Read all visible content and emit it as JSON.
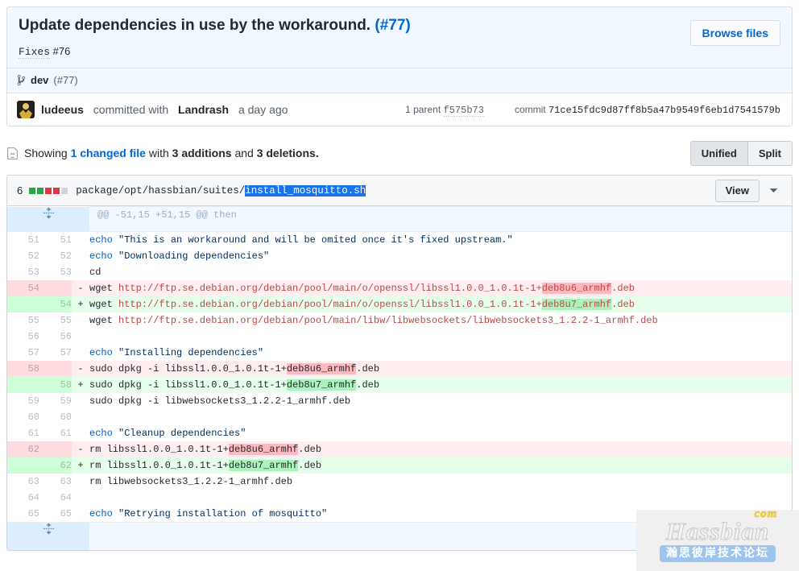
{
  "commit": {
    "title": "Update dependencies in use by the workaround.",
    "title_issue": "(#77)",
    "description_keyword": "Fixes",
    "description_issue": "#76",
    "browse_files_label": "Browse files",
    "branch_icon": "branch-icon",
    "branch_name": "dev",
    "branch_pr": "(#77)",
    "author": "ludeeus",
    "committed_with_text": "committed with",
    "coauthor": "Landrash",
    "time": "a day ago",
    "parent_label": "1 parent",
    "parent_sha": "f575b73",
    "commit_label": "commit",
    "commit_sha": "71ce15fdc9d87ff8b5a47b9549f6eb1d7541579b"
  },
  "toolbar": {
    "file_icon": "file-diff-icon",
    "showing": "Showing",
    "changed_files": "1 changed file",
    "with": "with",
    "additions": "3 additions",
    "and": "and",
    "deletions": "3 deletions.",
    "unified_label": "Unified",
    "split_label": "Split",
    "active_view": "Unified"
  },
  "file": {
    "change_count": "6",
    "diffstat": [
      "add",
      "add",
      "del",
      "del",
      "neu"
    ],
    "path_prefix": "package/opt/hassbian/suites/",
    "path_selected": "install_mosquitto.sh",
    "view_label": "View",
    "chevron_icon": "chevron-down-icon",
    "hunk_header": "@@ -51,15 +51,15 @@ then",
    "expand_icon": "unfold-icon"
  },
  "colors": {
    "accent": "#0366d6",
    "addition": "#28a745",
    "deletion": "#d73a49",
    "header_bg": "#f1f8ff",
    "selection": "#1a73e8"
  },
  "watermark": {
    "brand": "Hassbian",
    "tld": "com",
    "cn": "瀚思彼岸技术论坛"
  },
  "diff": {
    "rows": [
      {
        "type": "ctx",
        "old": "51",
        "new": "51",
        "marker": "",
        "parts": [
          {
            "t": "kw",
            "s": "echo"
          },
          {
            "t": "plain",
            "s": " "
          },
          {
            "t": "str",
            "s": "\"This is an workaround and will be omited once it's fixed upstream.\""
          }
        ]
      },
      {
        "type": "ctx",
        "old": "52",
        "new": "52",
        "marker": "",
        "parts": [
          {
            "t": "kw",
            "s": "echo"
          },
          {
            "t": "plain",
            "s": " "
          },
          {
            "t": "str",
            "s": "\"Downloading dependencies\""
          }
        ]
      },
      {
        "type": "ctx",
        "old": "53",
        "new": "53",
        "marker": "",
        "parts": [
          {
            "t": "plain",
            "s": "cd"
          }
        ]
      },
      {
        "type": "del",
        "old": "54",
        "new": "",
        "marker": "-",
        "parts": [
          {
            "t": "plain",
            "s": "wget "
          },
          {
            "t": "url",
            "s": "http://ftp.se.debian.org/debian/pool/main/o/openssl/libssl1.0.0_1.0.1t-1+"
          },
          {
            "t": "url",
            "s": "deb8u6_armhf",
            "hl": "del"
          },
          {
            "t": "url",
            "s": ".deb"
          }
        ]
      },
      {
        "type": "add",
        "old": "",
        "new": "54",
        "marker": "+",
        "parts": [
          {
            "t": "plain",
            "s": "wget "
          },
          {
            "t": "url",
            "s": "http://ftp.se.debian.org/debian/pool/main/o/openssl/libssl1.0.0_1.0.1t-1+"
          },
          {
            "t": "url",
            "s": "deb8u7_armhf",
            "hl": "add"
          },
          {
            "t": "url",
            "s": ".deb"
          }
        ]
      },
      {
        "type": "ctx",
        "old": "55",
        "new": "55",
        "marker": "",
        "parts": [
          {
            "t": "plain",
            "s": "wget "
          },
          {
            "t": "url",
            "s": "http://ftp.se.debian.org/debian/pool/main/libw/libwebsockets/libwebsockets3_1.2.2-1_armhf.deb"
          }
        ]
      },
      {
        "type": "ctx",
        "old": "56",
        "new": "56",
        "marker": "",
        "parts": []
      },
      {
        "type": "ctx",
        "old": "57",
        "new": "57",
        "marker": "",
        "parts": [
          {
            "t": "kw",
            "s": "echo"
          },
          {
            "t": "plain",
            "s": " "
          },
          {
            "t": "str",
            "s": "\"Installing dependencies\""
          }
        ]
      },
      {
        "type": "del",
        "old": "58",
        "new": "",
        "marker": "-",
        "parts": [
          {
            "t": "plain",
            "s": "sudo dpkg -i libssl1.0.0_1.0.1t-1+"
          },
          {
            "t": "plain",
            "s": "deb8u6_armhf",
            "hl": "del"
          },
          {
            "t": "plain",
            "s": ".deb"
          }
        ]
      },
      {
        "type": "add",
        "old": "",
        "new": "58",
        "marker": "+",
        "parts": [
          {
            "t": "plain",
            "s": "sudo dpkg -i libssl1.0.0_1.0.1t-1+"
          },
          {
            "t": "plain",
            "s": "deb8u7_armhf",
            "hl": "add"
          },
          {
            "t": "plain",
            "s": ".deb"
          }
        ]
      },
      {
        "type": "ctx",
        "old": "59",
        "new": "59",
        "marker": "",
        "parts": [
          {
            "t": "plain",
            "s": "sudo dpkg -i libwebsockets3_1.2.2-1_armhf.deb"
          }
        ]
      },
      {
        "type": "ctx",
        "old": "60",
        "new": "60",
        "marker": "",
        "parts": []
      },
      {
        "type": "ctx",
        "old": "61",
        "new": "61",
        "marker": "",
        "parts": [
          {
            "t": "kw",
            "s": "echo"
          },
          {
            "t": "plain",
            "s": " "
          },
          {
            "t": "str",
            "s": "\"Cleanup dependencies\""
          }
        ]
      },
      {
        "type": "del",
        "old": "62",
        "new": "",
        "marker": "-",
        "parts": [
          {
            "t": "plain",
            "s": "rm libssl1.0.0_1.0.1t-1+"
          },
          {
            "t": "plain",
            "s": "deb8u6_armhf",
            "hl": "del"
          },
          {
            "t": "plain",
            "s": ".deb"
          }
        ]
      },
      {
        "type": "add",
        "old": "",
        "new": "62",
        "marker": "+",
        "parts": [
          {
            "t": "plain",
            "s": "rm libssl1.0.0_1.0.1t-1+"
          },
          {
            "t": "plain",
            "s": "deb8u7_armhf",
            "hl": "add"
          },
          {
            "t": "plain",
            "s": ".deb"
          }
        ]
      },
      {
        "type": "ctx",
        "old": "63",
        "new": "63",
        "marker": "",
        "parts": [
          {
            "t": "plain",
            "s": "rm libwebsockets3_1.2.2-1_armhf.deb"
          }
        ]
      },
      {
        "type": "ctx",
        "old": "64",
        "new": "64",
        "marker": "",
        "parts": []
      },
      {
        "type": "ctx",
        "old": "65",
        "new": "65",
        "marker": "",
        "parts": [
          {
            "t": "kw",
            "s": "echo"
          },
          {
            "t": "plain",
            "s": " "
          },
          {
            "t": "str",
            "s": "\"Retrying installation of mosquitto\""
          }
        ]
      }
    ]
  }
}
